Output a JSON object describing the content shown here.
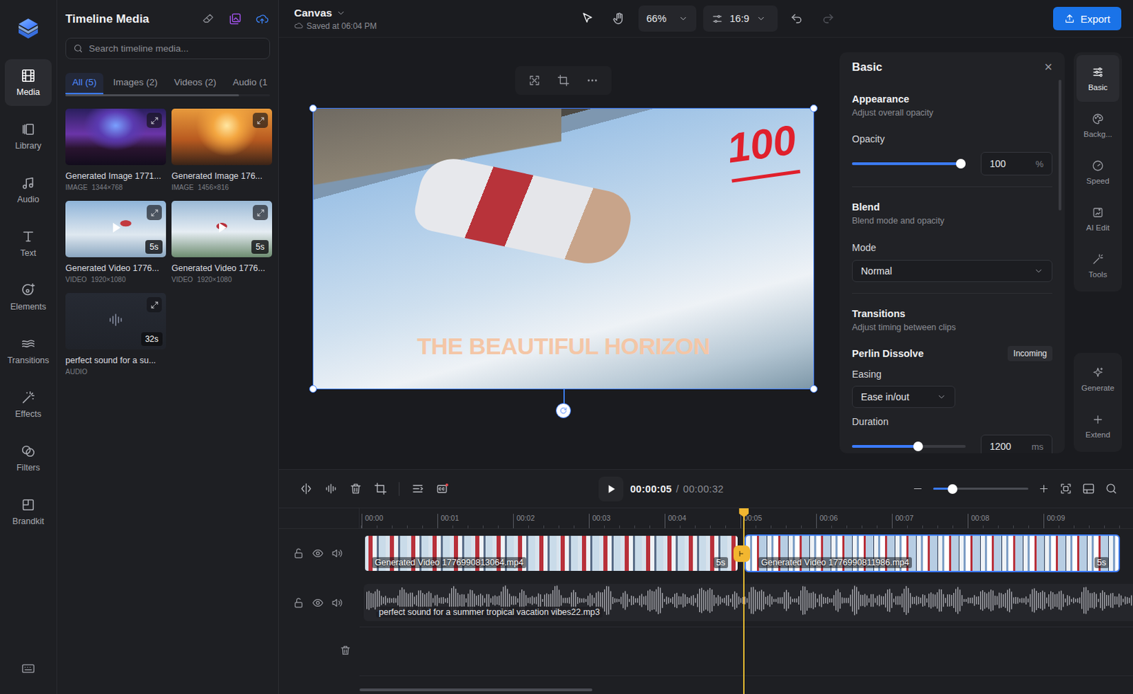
{
  "rail": {
    "items": [
      {
        "label": "Media",
        "selected": true
      },
      {
        "label": "Library",
        "selected": false
      },
      {
        "label": "Audio",
        "selected": false
      },
      {
        "label": "Text",
        "selected": false
      },
      {
        "label": "Elements",
        "selected": false
      },
      {
        "label": "Transitions",
        "selected": false
      },
      {
        "label": "Effects",
        "selected": false
      },
      {
        "label": "Filters",
        "selected": false
      },
      {
        "label": "Brandkit",
        "selected": false
      }
    ]
  },
  "media_panel": {
    "title": "Timeline Media",
    "search": {
      "placeholder": "Search timeline media..."
    },
    "tabs": [
      {
        "label": "All (5)",
        "selected": true
      },
      {
        "label": "Images (2)",
        "selected": false
      },
      {
        "label": "Videos (2)",
        "selected": false
      },
      {
        "label": "Audio (1",
        "selected": false
      }
    ],
    "items": [
      {
        "kind": "image",
        "name": "Generated Image 1771...",
        "type": "IMAGE",
        "dims": "1344×768"
      },
      {
        "kind": "image",
        "name": "Generated Image 176...",
        "type": "IMAGE",
        "dims": "1456×816"
      },
      {
        "kind": "video",
        "name": "Generated Video 1776...",
        "type": "VIDEO",
        "dims": "1920×1080",
        "duration": "5s"
      },
      {
        "kind": "video",
        "name": "Generated Video 1776...",
        "type": "VIDEO",
        "dims": "1920×1080",
        "duration": "5s"
      },
      {
        "kind": "audio",
        "name": "perfect sound for a su...",
        "type": "AUDIO",
        "duration": "32s"
      }
    ]
  },
  "header": {
    "project": "Canvas",
    "saved": "Saved at 06:04 PM",
    "zoom": "66%",
    "aspect": "16:9",
    "export": "Export"
  },
  "canvas": {
    "selected": true,
    "text_layer": "THE BEAUTIFUL HORIZON",
    "sticker": "100"
  },
  "properties": {
    "title": "Basic",
    "close": "×",
    "appearance": {
      "title": "Appearance",
      "subtitle": "Adjust overall opacity",
      "opacity": {
        "label": "Opacity",
        "level": 0.96,
        "value": "100",
        "unit": "%"
      }
    },
    "blend": {
      "title": "Blend",
      "subtitle": "Blend mode and opacity",
      "mode_label": "Mode",
      "mode": "Normal"
    },
    "transitions": {
      "title": "Transitions",
      "subtitle": "Adjust timing between clips",
      "name": "Perlin Dissolve",
      "badge": "Incoming",
      "easing_label": "Easing",
      "easing": "Ease in/out",
      "duration": {
        "label": "Duration",
        "level": 0.58,
        "value": "1200",
        "unit": "ms"
      }
    }
  },
  "tools": {
    "items": [
      {
        "label": "Basic",
        "selected": true
      },
      {
        "label": "Backg...",
        "selected": false
      },
      {
        "label": "Speed",
        "selected": false
      },
      {
        "label": "AI Edit",
        "selected": false
      },
      {
        "label": "Tools",
        "selected": false
      }
    ],
    "actions": [
      {
        "label": "Generate"
      },
      {
        "label": "Extend"
      }
    ]
  },
  "timeline": {
    "current": "00:00:05",
    "separator": "/",
    "total": "00:00:32",
    "zoom_level": 0.2,
    "playhead_level": 0.497,
    "ruler": [
      "00:00",
      "00:01",
      "00:02",
      "00:03",
      "00:04",
      "00:05",
      "00:06",
      "00:07",
      "00:08",
      "00:09"
    ],
    "tracks": [
      {
        "kind": "video",
        "locked": false,
        "visible": true,
        "muted": false,
        "clips": [
          {
            "name": "Generated Video 1776990813064.mp4",
            "duration": "5s",
            "selected": false
          },
          {
            "name": "Generated Video 1776990811986.mp4",
            "duration": "5s",
            "selected": true
          }
        ],
        "transition": {
          "selected": true
        }
      },
      {
        "kind": "audio",
        "locked": false,
        "visible": true,
        "muted": false,
        "clips": [
          {
            "name": "perfect sound for a summer tropical vacation vibes22.mp3",
            "selected": false
          }
        ]
      },
      {
        "kind": "empty"
      }
    ]
  }
}
